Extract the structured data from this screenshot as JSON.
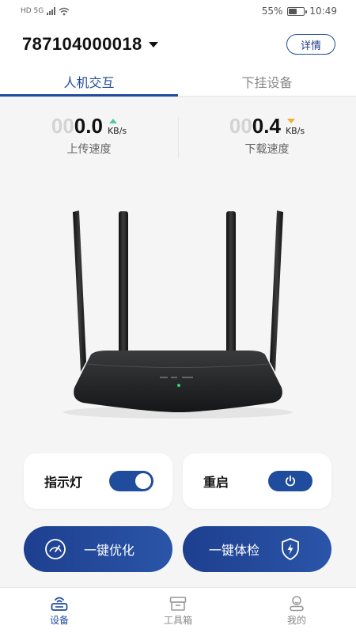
{
  "status_bar": {
    "network": "HD 5G",
    "battery": "55%",
    "battery_level": 0.55,
    "time": "10:49"
  },
  "header": {
    "device_id": "787104000018",
    "details_label": "详情"
  },
  "tabs": [
    {
      "label": "人机交互",
      "active": true
    },
    {
      "label": "下挂设备",
      "active": false
    }
  ],
  "upload": {
    "ghost": "00",
    "value": "0.0",
    "unit": "KB/s",
    "label": "上传速度"
  },
  "download": {
    "ghost": "00",
    "value": "0.4",
    "unit": "KB/s",
    "label": "下载速度"
  },
  "indicator": {
    "label": "指示灯",
    "on": true
  },
  "reboot": {
    "label": "重启"
  },
  "actions": {
    "optimize_label": "一键优化",
    "checkup_label": "一键体检"
  },
  "nav": [
    {
      "label": "设备",
      "icon": "router-icon",
      "active": true
    },
    {
      "label": "工具箱",
      "icon": "toolbox-icon",
      "active": false
    },
    {
      "label": "我的",
      "icon": "user-icon",
      "active": false
    }
  ],
  "colors": {
    "primary": "#1f4c9c",
    "upload_arrow": "#53c7a4",
    "download_arrow": "#f0b028"
  }
}
